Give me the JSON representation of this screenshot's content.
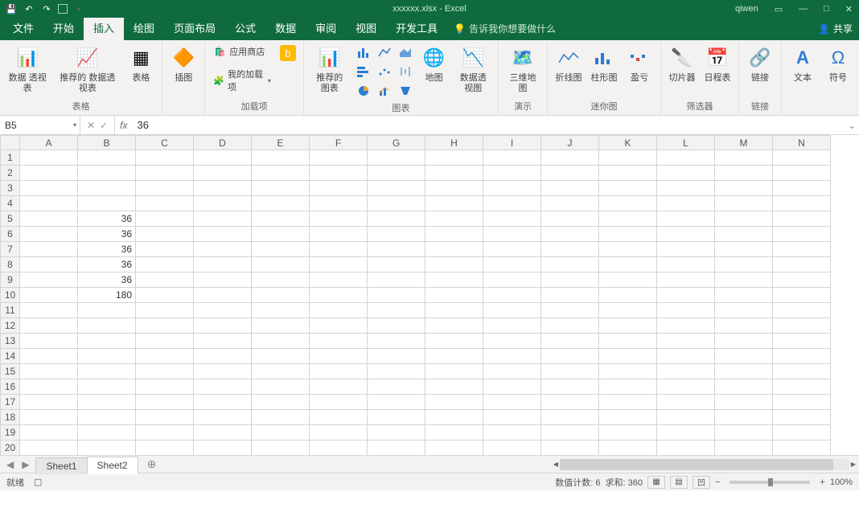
{
  "app": {
    "title": "xxxxxx.xlsx - Excel",
    "user": "qiwen"
  },
  "qat": [
    "save",
    "undo",
    "redo",
    "range",
    "more"
  ],
  "tabs": [
    "文件",
    "开始",
    "插入",
    "绘图",
    "页面布局",
    "公式",
    "数据",
    "审阅",
    "视图",
    "开发工具"
  ],
  "tellme": "告诉我你想要做什么",
  "share": "共享",
  "ribbon": {
    "tables": {
      "btns": [
        "数据\n透视表",
        "推荐的\n数据透视表",
        "表格"
      ],
      "label": "表格"
    },
    "illus": {
      "btn": "插图",
      "label": ""
    },
    "addins": {
      "app_store": "应用商店",
      "my_addins": "我的加载项",
      "bing": "",
      "label": "加载项"
    },
    "charts": {
      "rec": "推荐的\n图表",
      "label": "图表",
      "map": "地图",
      "pivotchart": "数据透视图"
    },
    "demo": {
      "btn": "三维地\n图",
      "label": "演示"
    },
    "sparklines": {
      "btns": [
        "折线图",
        "柱形图",
        "盈亏"
      ],
      "label": "迷你图"
    },
    "filters": {
      "btns": [
        "切片器",
        "日程表"
      ],
      "label": "筛选器"
    },
    "links": {
      "btn": "链接",
      "label": "链接"
    },
    "text": {
      "btn": "文本",
      "label": ""
    },
    "symbol": {
      "btn": "符号",
      "label": ""
    }
  },
  "namebox": {
    "ref": "B5",
    "formula": "36"
  },
  "cols": [
    "A",
    "B",
    "C",
    "D",
    "E",
    "F",
    "G",
    "H",
    "I",
    "J",
    "K",
    "L",
    "M",
    "N"
  ],
  "rows": [
    1,
    2,
    3,
    4,
    5,
    6,
    7,
    8,
    9,
    10,
    11,
    12,
    13,
    14,
    15,
    16,
    17,
    18,
    19,
    20
  ],
  "cells": {
    "B5": "36",
    "B6": "36",
    "B7": "36",
    "B8": "36",
    "B9": "36",
    "B10": "180"
  },
  "sheets": {
    "list": [
      "Sheet1",
      "Sheet2"
    ],
    "active": 1
  },
  "status": {
    "ready": "就绪",
    "count_lbl": "数值计数:",
    "count": "6",
    "sum_lbl": "求和:",
    "sum": "360",
    "zoom": "100%"
  }
}
